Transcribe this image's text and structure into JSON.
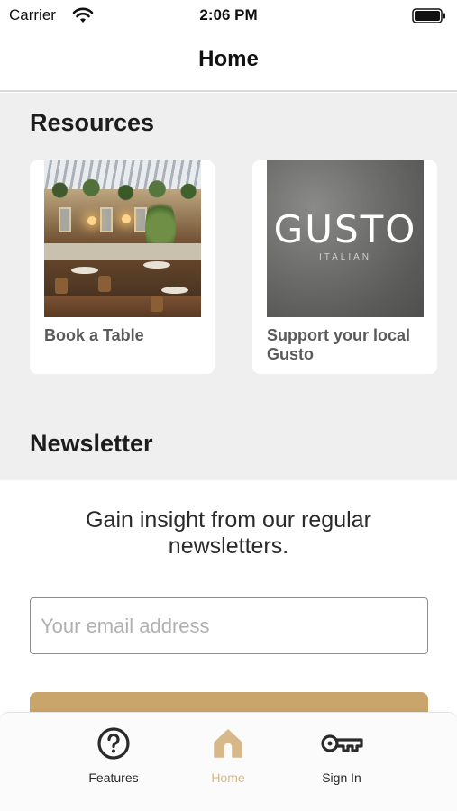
{
  "status_bar": {
    "carrier": "Carrier",
    "time": "2:06 PM"
  },
  "nav": {
    "title": "Home"
  },
  "resources": {
    "title": "Resources",
    "cards": [
      {
        "label": "Book a Table",
        "image": "restaurant-interior-photo"
      },
      {
        "label": "Support your local Gusto",
        "image": "gusto-italian-logo",
        "logo_word": "GUSTO",
        "logo_sub": "ITALIAN"
      }
    ]
  },
  "newsletter": {
    "title": "Newsletter",
    "description": "Gain insight from our regular newsletters.",
    "email_placeholder": "Your email address",
    "button_color": "#c9a56c"
  },
  "tab_bar": {
    "active": "Home",
    "accent_color": "#d6b88a",
    "tabs": [
      {
        "label": "Features",
        "icon": "question-circle-icon"
      },
      {
        "label": "Home",
        "icon": "home-icon"
      },
      {
        "label": "Sign In",
        "icon": "key-icon"
      }
    ]
  }
}
